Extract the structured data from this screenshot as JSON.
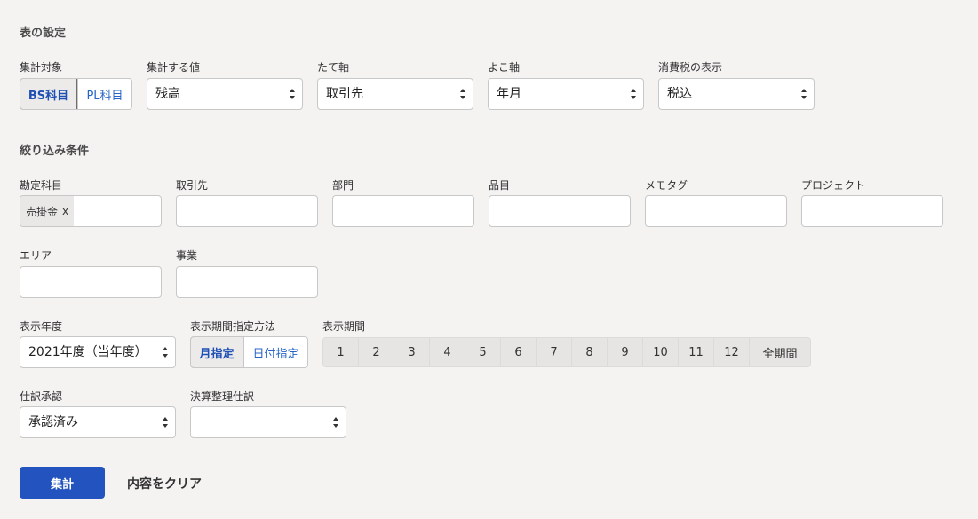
{
  "table_settings": {
    "title": "表の設定",
    "target": {
      "label": "集計対象",
      "options": [
        "BS科目",
        "PL科目"
      ],
      "selected": "BS科目"
    },
    "value": {
      "label": "集計する値",
      "selected": "残高"
    },
    "vertical_axis": {
      "label": "たて軸",
      "selected": "取引先"
    },
    "horizontal_axis": {
      "label": "よこ軸",
      "selected": "年月"
    },
    "tax_display": {
      "label": "消費税の表示",
      "selected": "税込"
    }
  },
  "filters": {
    "title": "絞り込み条件",
    "account": {
      "label": "勘定科目",
      "tag": "売掛金",
      "tag_remove": "x"
    },
    "partner": {
      "label": "取引先"
    },
    "department": {
      "label": "部門"
    },
    "item": {
      "label": "品目"
    },
    "memo_tag": {
      "label": "メモタグ"
    },
    "project": {
      "label": "プロジェクト"
    },
    "area": {
      "label": "エリア"
    },
    "business": {
      "label": "事業"
    },
    "fiscal_year": {
      "label": "表示年度",
      "selected": "2021年度（当年度）"
    },
    "period_method": {
      "label": "表示期間指定方法",
      "options": [
        "月指定",
        "日付指定"
      ],
      "selected": "月指定"
    },
    "period": {
      "label": "表示期間",
      "months": [
        "1",
        "2",
        "3",
        "4",
        "5",
        "6",
        "7",
        "8",
        "9",
        "10",
        "11",
        "12"
      ],
      "all": "全期間"
    },
    "journal_approval": {
      "label": "仕訳承認",
      "selected": "承認済み"
    },
    "closing_entries": {
      "label": "決算整理仕訳",
      "selected": ""
    }
  },
  "actions": {
    "submit": "集計",
    "clear": "内容をクリア"
  }
}
